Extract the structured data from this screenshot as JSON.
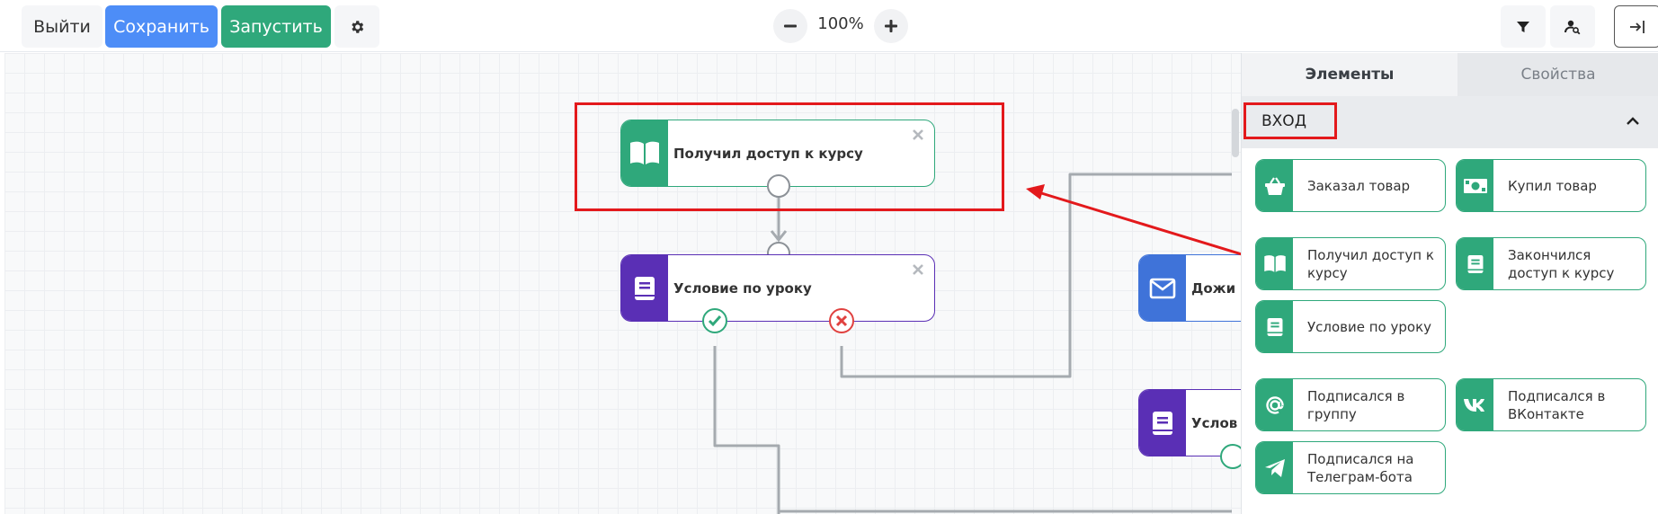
{
  "toolbar": {
    "exit_label": "Выйти",
    "save_label": "Сохранить",
    "run_label": "Запустить",
    "zoom_level": "100%"
  },
  "colors": {
    "save": "#4d8df7",
    "run": "#2fa87b",
    "node_green": "#2fa87b",
    "node_purple": "#5a2fb5",
    "node_blue": "#3f73d9",
    "highlight": "#e3191c"
  },
  "canvas": {
    "nodes": [
      {
        "title": "Получил доступ к курсу",
        "icon": "open-book-icon"
      },
      {
        "title": "Условие по уроку",
        "icon": "book-icon"
      },
      {
        "title": "Дожи",
        "icon": "envelope-icon"
      },
      {
        "title": "Услов",
        "icon": "book-icon"
      }
    ]
  },
  "sidebar": {
    "tabs": [
      {
        "label": "Элементы",
        "active": true
      },
      {
        "label": "Свойства",
        "active": false
      }
    ],
    "section": {
      "title": "ВХОД",
      "expanded": true
    },
    "items": [
      {
        "label": "Заказал товар",
        "icon": "basket-icon"
      },
      {
        "label": "Купил товар",
        "icon": "money-icon"
      },
      {
        "label": "Получил доступ к курсу",
        "icon": "open-book-icon"
      },
      {
        "label": "Закончился доступ к курсу",
        "icon": "book-icon"
      },
      {
        "label": "Условие по уроку",
        "icon": "book-icon"
      },
      {
        "label": "Подписался в группу",
        "icon": "at-icon"
      },
      {
        "label": "Подписался в ВКонтакте",
        "icon": "vk-icon"
      },
      {
        "label": "Подписался на Телеграм-бота",
        "icon": "telegram-icon"
      }
    ]
  }
}
